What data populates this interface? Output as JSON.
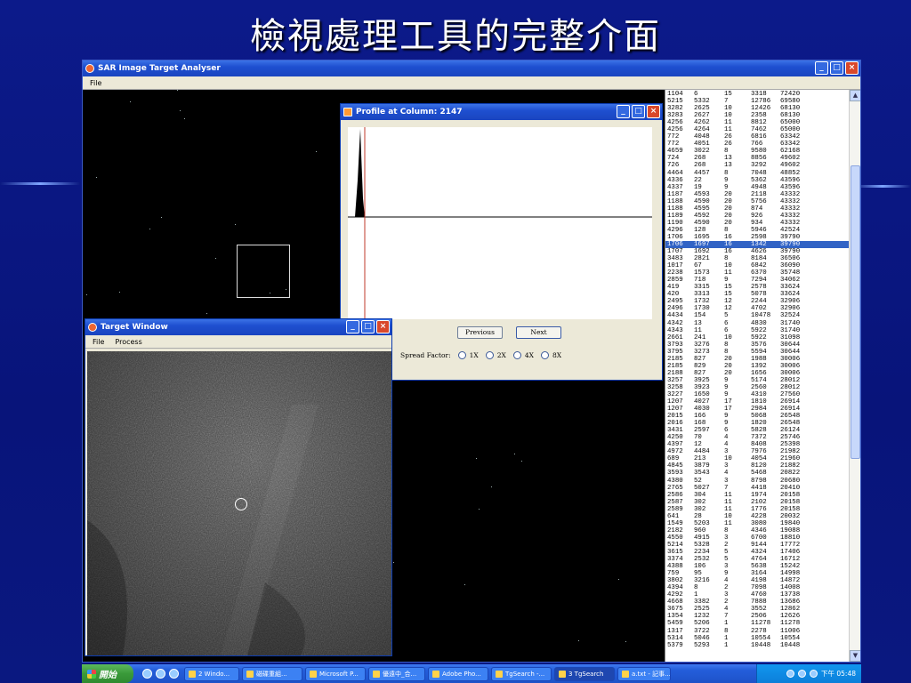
{
  "slide": {
    "title": "檢視處理工具的完整介面"
  },
  "main_window": {
    "title": "SAR Image Target Analyser",
    "menu": [
      "File"
    ]
  },
  "profile_window": {
    "title": "Profile at Column: 2147",
    "previous_label": "Previous",
    "next_label": "Next",
    "spread_label": "Spread Factor:",
    "spread_options": [
      "1X",
      "2X",
      "4X",
      "8X"
    ]
  },
  "target_window": {
    "title": "Target Window",
    "menu": [
      "File",
      "Process"
    ]
  },
  "list": {
    "selected_index": 21,
    "rows": [
      [
        "1104",
        "6",
        "15",
        "3318",
        "72420"
      ],
      [
        "5215",
        "5332",
        "7",
        "12786",
        "69580"
      ],
      [
        "3282",
        "2625",
        "10",
        "12426",
        "68130"
      ],
      [
        "3283",
        "2627",
        "10",
        "2358",
        "68130"
      ],
      [
        "4256",
        "4262",
        "11",
        "8812",
        "65000"
      ],
      [
        "4256",
        "4264",
        "11",
        "7462",
        "65000"
      ],
      [
        "772",
        "4048",
        "26",
        "6816",
        "63342"
      ],
      [
        "772",
        "4051",
        "26",
        "766",
        "63342"
      ],
      [
        "4659",
        "3022",
        "8",
        "9580",
        "62168"
      ],
      [
        "724",
        "268",
        "13",
        "8856",
        "49602"
      ],
      [
        "726",
        "268",
        "13",
        "3292",
        "49602"
      ],
      [
        "4464",
        "4457",
        "8",
        "7048",
        "48852"
      ],
      [
        "4336",
        "22",
        "9",
        "5362",
        "43596"
      ],
      [
        "4337",
        "19",
        "9",
        "4948",
        "43596"
      ],
      [
        "1187",
        "4593",
        "20",
        "2118",
        "43332"
      ],
      [
        "1188",
        "4590",
        "20",
        "5756",
        "43332"
      ],
      [
        "1188",
        "4595",
        "20",
        "874",
        "43332"
      ],
      [
        "1189",
        "4592",
        "20",
        "926",
        "43332"
      ],
      [
        "1190",
        "4590",
        "20",
        "934",
        "43332"
      ],
      [
        "4296",
        "128",
        "8",
        "5946",
        "42524"
      ],
      [
        "1706",
        "1695",
        "16",
        "2598",
        "39790"
      ],
      [
        "1706",
        "1697",
        "16",
        "1342",
        "39790"
      ],
      [
        "1707",
        "1692",
        "16",
        "4626",
        "39790"
      ],
      [
        "3483",
        "2821",
        "8",
        "8184",
        "36506"
      ],
      [
        "1017",
        "67",
        "10",
        "6842",
        "36090"
      ],
      [
        "2238",
        "1573",
        "11",
        "6370",
        "35748"
      ],
      [
        "2859",
        "718",
        "9",
        "7294",
        "34062"
      ],
      [
        "419",
        "3315",
        "15",
        "2578",
        "33624"
      ],
      [
        "420",
        "3313",
        "15",
        "5078",
        "33624"
      ],
      [
        "2495",
        "1732",
        "12",
        "2244",
        "32906"
      ],
      [
        "2496",
        "1730",
        "12",
        "4702",
        "32906"
      ],
      [
        "4434",
        "154",
        "5",
        "10478",
        "32524"
      ],
      [
        "4342",
        "13",
        "6",
        "4830",
        "31740"
      ],
      [
        "4343",
        "11",
        "6",
        "5922",
        "31740"
      ],
      [
        "2661",
        "241",
        "10",
        "5922",
        "31098"
      ],
      [
        "3793",
        "3276",
        "8",
        "3576",
        "30644"
      ],
      [
        "3795",
        "3273",
        "8",
        "5594",
        "30644"
      ],
      [
        "2185",
        "827",
        "20",
        "1988",
        "30006"
      ],
      [
        "2185",
        "829",
        "20",
        "1392",
        "30006"
      ],
      [
        "2188",
        "827",
        "20",
        "1656",
        "30006"
      ],
      [
        "3257",
        "3925",
        "9",
        "5174",
        "28012"
      ],
      [
        "3258",
        "3923",
        "9",
        "2560",
        "28012"
      ],
      [
        "3227",
        "1650",
        "9",
        "4310",
        "27560"
      ],
      [
        "1207",
        "4027",
        "17",
        "1810",
        "26914"
      ],
      [
        "1207",
        "4030",
        "17",
        "2984",
        "26914"
      ],
      [
        "2015",
        "166",
        "9",
        "5068",
        "26548"
      ],
      [
        "2016",
        "168",
        "9",
        "1820",
        "26548"
      ],
      [
        "3431",
        "2597",
        "6",
        "5828",
        "26124"
      ],
      [
        "4250",
        "70",
        "4",
        "7372",
        "25746"
      ],
      [
        "4397",
        "12",
        "4",
        "8408",
        "25398"
      ],
      [
        "4972",
        "4484",
        "3",
        "7976",
        "21982"
      ],
      [
        "689",
        "213",
        "10",
        "4054",
        "21960"
      ],
      [
        "4845",
        "3879",
        "3",
        "8120",
        "21882"
      ],
      [
        "3593",
        "3543",
        "4",
        "5468",
        "20822"
      ],
      [
        "4380",
        "52",
        "3",
        "8798",
        "20680"
      ],
      [
        "2765",
        "5027",
        "7",
        "4418",
        "20410"
      ],
      [
        "2586",
        "304",
        "11",
        "1974",
        "20158"
      ],
      [
        "2587",
        "302",
        "11",
        "2102",
        "20158"
      ],
      [
        "2589",
        "302",
        "11",
        "1776",
        "20158"
      ],
      [
        "641",
        "28",
        "10",
        "4228",
        "20032"
      ],
      [
        "1549",
        "5203",
        "11",
        "3080",
        "19840"
      ],
      [
        "2182",
        "960",
        "8",
        "4346",
        "19088"
      ],
      [
        "4550",
        "4915",
        "3",
        "6700",
        "18810"
      ],
      [
        "5214",
        "5328",
        "2",
        "9144",
        "17772"
      ],
      [
        "3615",
        "2234",
        "5",
        "4324",
        "17406"
      ],
      [
        "3374",
        "2532",
        "5",
        "4764",
        "16712"
      ],
      [
        "4388",
        "106",
        "3",
        "5638",
        "15242"
      ],
      [
        "759",
        "95",
        "9",
        "3164",
        "14998"
      ],
      [
        "3802",
        "3216",
        "4",
        "4198",
        "14872"
      ],
      [
        "4394",
        "8",
        "2",
        "7098",
        "14008"
      ],
      [
        "4292",
        "1",
        "3",
        "4760",
        "13738"
      ],
      [
        "4668",
        "3382",
        "2",
        "7888",
        "13686"
      ],
      [
        "3675",
        "2525",
        "4",
        "3552",
        "12862"
      ],
      [
        "1354",
        "1232",
        "7",
        "2506",
        "12626"
      ],
      [
        "5459",
        "5206",
        "1",
        "11278",
        "11278"
      ],
      [
        "1317",
        "3722",
        "8",
        "2278",
        "11006"
      ],
      [
        "5314",
        "5046",
        "1",
        "10554",
        "10554"
      ],
      [
        "5379",
        "5293",
        "1",
        "10448",
        "10448"
      ]
    ]
  },
  "taskbar": {
    "start": "開始",
    "tasks": [
      "2 Windo...",
      "磁碟重組...",
      "Microsoft P...",
      "優遠中_合...",
      "Adobe Pho...",
      "TgSearch -...",
      "3 TgSearch",
      "a.txt - 記事..."
    ],
    "clock": "下午 05:48"
  }
}
